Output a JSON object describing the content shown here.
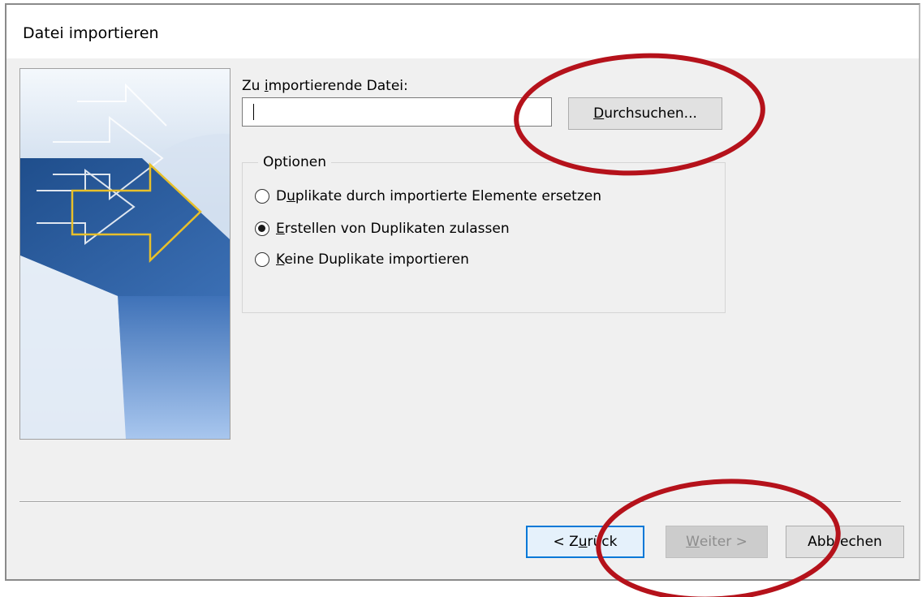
{
  "window": {
    "title": "Datei importieren"
  },
  "file": {
    "label_pre": "Zu ",
    "label_key": "i",
    "label_post": "mportierende Datei:",
    "value": ""
  },
  "browse": {
    "key": "D",
    "rest": "urchsuchen..."
  },
  "options": {
    "legend": "Optionen",
    "items": [
      {
        "pre": "D",
        "key": "u",
        "post": "plikate durch importierte Elemente ersetzen",
        "checked": false
      },
      {
        "pre": "",
        "key": "E",
        "post": "rstellen von Duplikaten zulassen",
        "checked": true
      },
      {
        "pre": "",
        "key": "K",
        "post": "eine Duplikate importieren",
        "checked": false
      }
    ]
  },
  "footer": {
    "back": {
      "pre": "< Z",
      "key": "u",
      "post": "rück"
    },
    "next": {
      "key": "W",
      "post": "eiter >"
    },
    "cancel": {
      "label": "Abbrechen"
    }
  },
  "colors": {
    "annotation": "#b5121b",
    "focus_border": "#0078d7",
    "art_dark_blue": "#1f4e8c",
    "art_arrow": "#e8c02a"
  }
}
